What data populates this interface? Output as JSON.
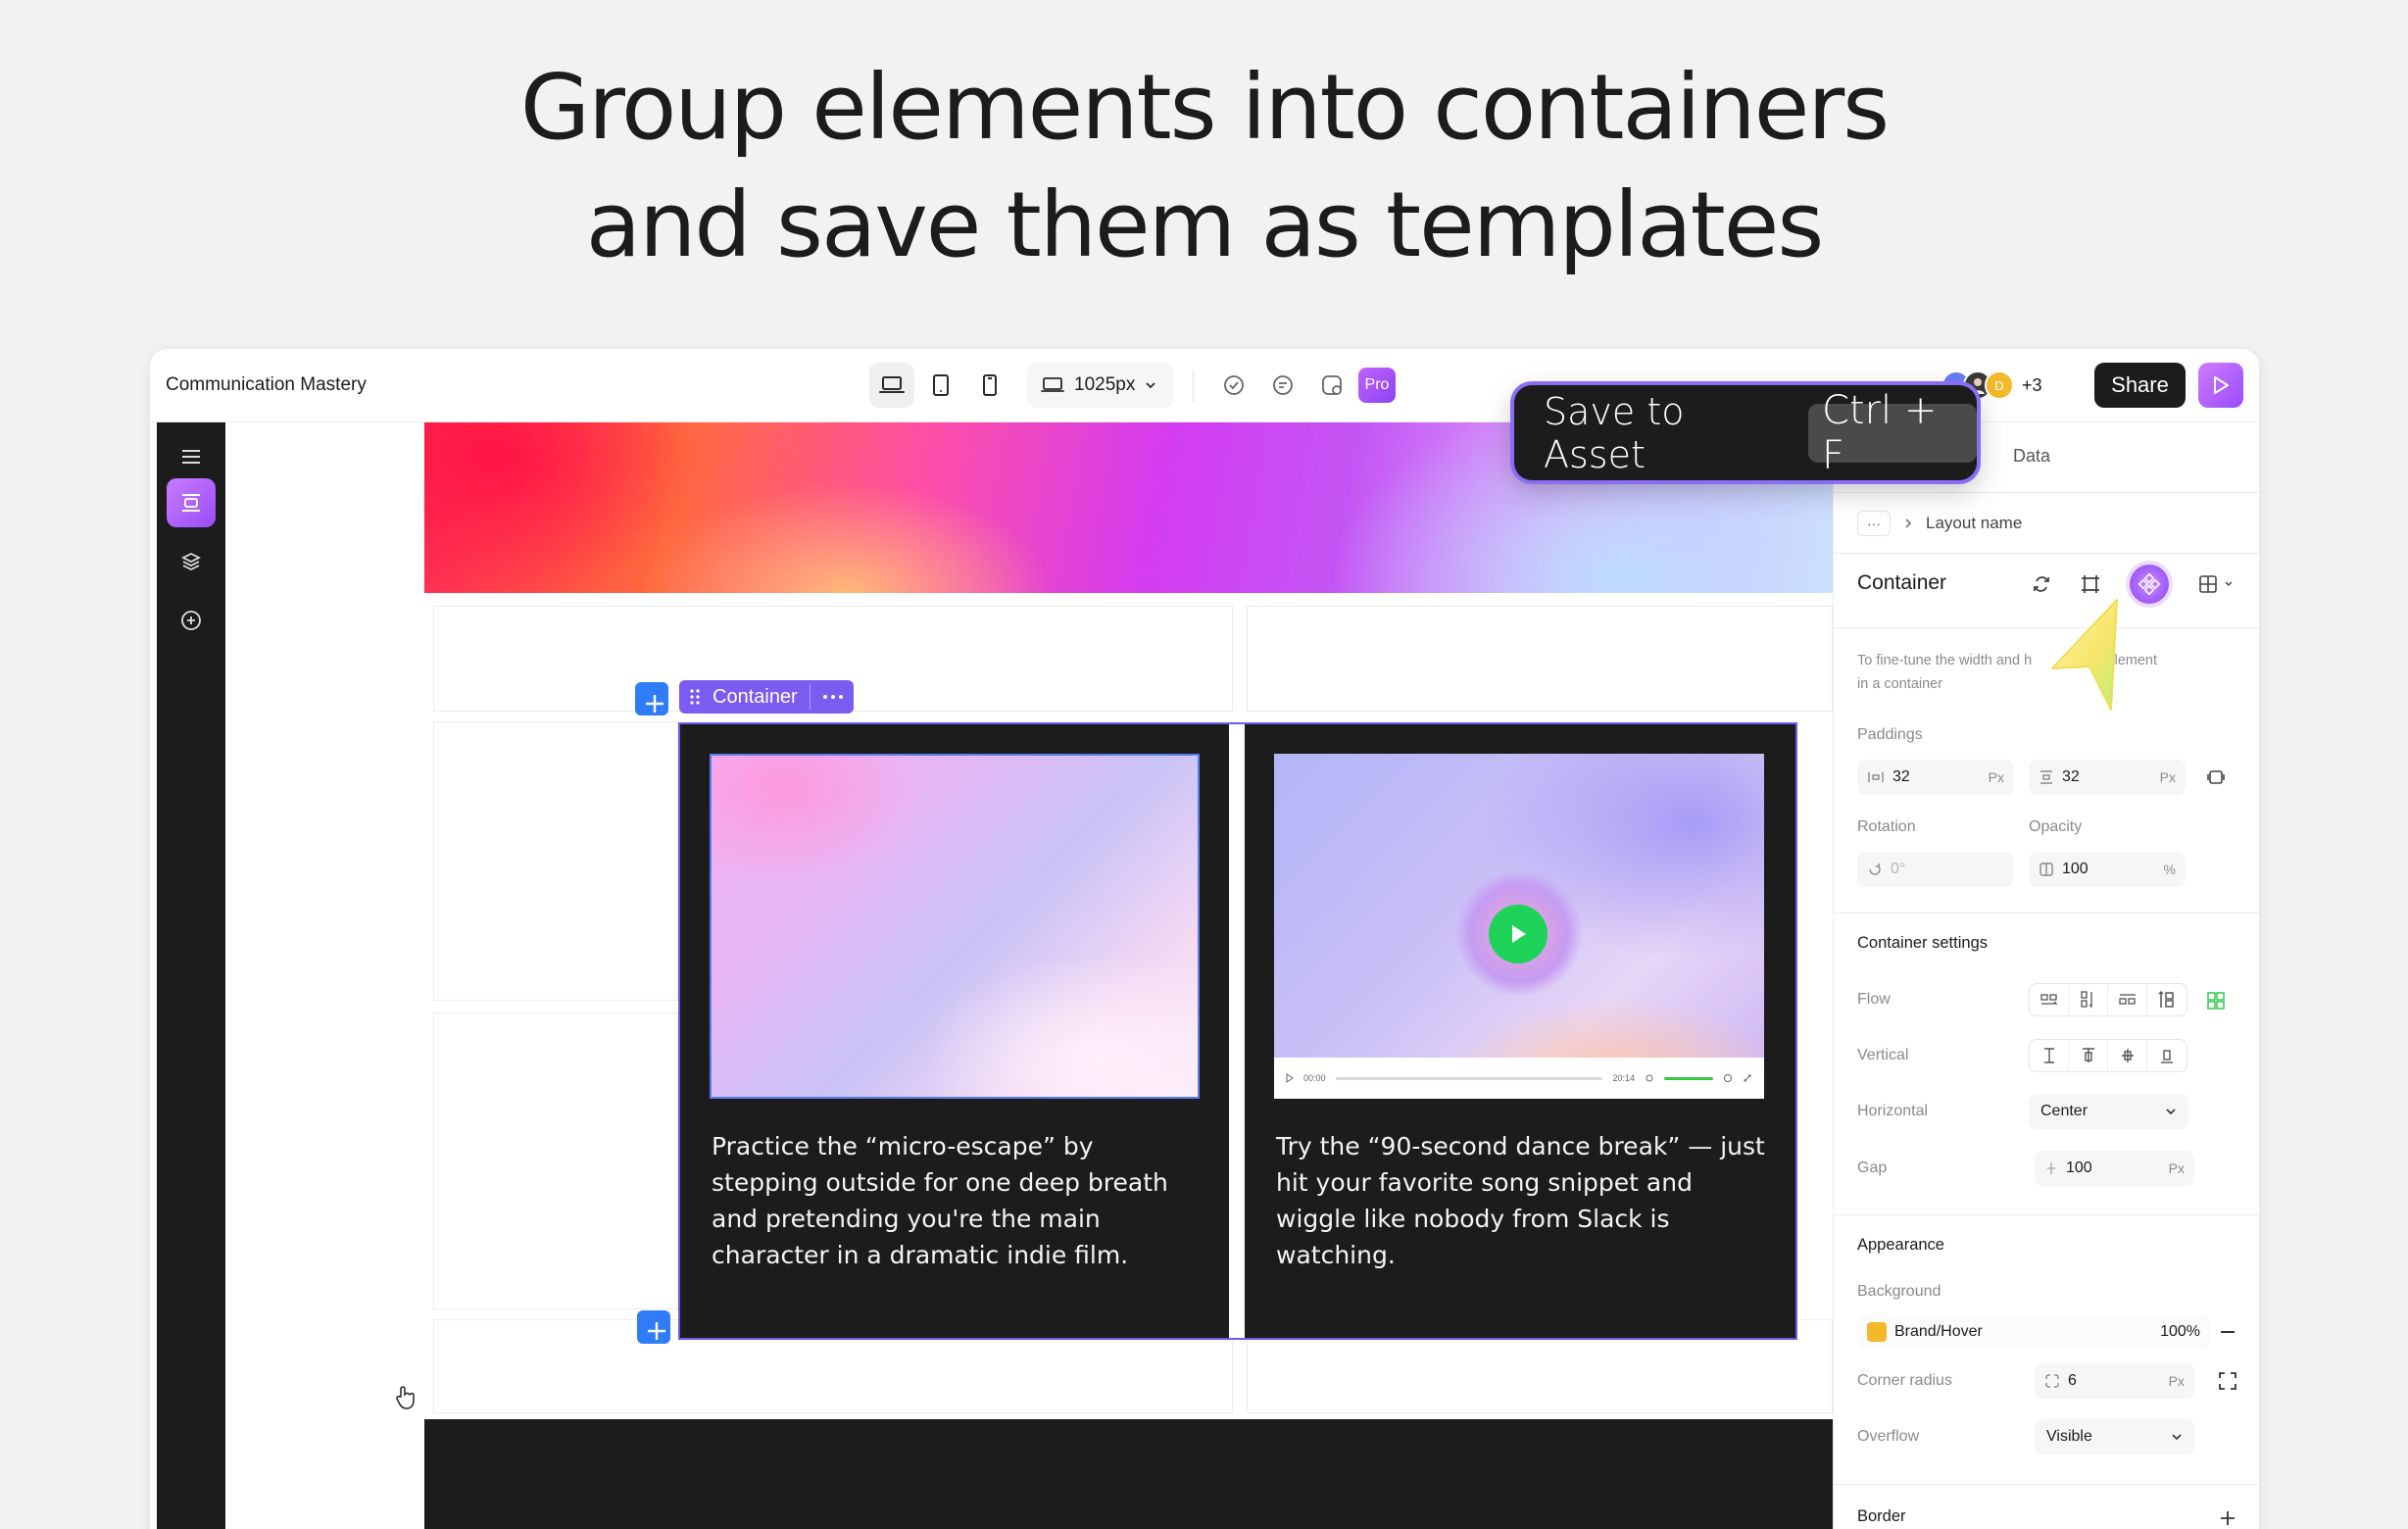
{
  "headline": {
    "line1": "Group elements into containers",
    "line2": "and save them as templates"
  },
  "topbar": {
    "title": "Communication Mastery",
    "devices": [
      "laptop-icon",
      "tablet-icon",
      "phone-icon"
    ],
    "width_value": "1025px",
    "tools": [
      "check-circle-icon",
      "comment-icon",
      "crop-icon"
    ],
    "pro_label": "Pro",
    "avatars": [
      {
        "initial": "M",
        "color": "#6b7cf5"
      },
      {
        "initial": "",
        "color": "#3a3a3a"
      },
      {
        "initial": "D",
        "color": "#f4b92a"
      }
    ],
    "more_users": "+3",
    "share_label": "Share"
  },
  "leftbar": {
    "items": [
      "menu-icon",
      "container-icon",
      "layers-icon",
      "add-circle-icon"
    ]
  },
  "canvas": {
    "container_tag_label": "Container",
    "cards": [
      {
        "text": "Practice the “micro-escape” by stepping outside for one deep breath and pretending you're the main character in a dramatic indie film."
      },
      {
        "text": "Try the “90-second dance break” — just hit your favorite song snippet and wiggle like nobody from Slack is watching.",
        "video_time_start": "00:00",
        "video_time_end": "20:14"
      }
    ]
  },
  "shortcut": {
    "label": "Save to Asset",
    "keys": "Ctrl + F"
  },
  "panel": {
    "tabs": [
      "t",
      "Data"
    ],
    "breadcrumb_more": "···",
    "breadcrumb_current": "Layout name",
    "title": "Container",
    "hint": "To fine-tune the width and h... to the element in a container",
    "hint_left": "To fine-tune the width and h",
    "hint_right": "o the element",
    "hint_line2": "in a container",
    "paddings_label": "Paddings",
    "padding_h": "32",
    "padding_v": "32",
    "px_unit": "Px",
    "rotation_label": "Rotation",
    "rotation_value": "0°",
    "opacity_label": "Opacity",
    "opacity_value": "100",
    "percent_unit": "%",
    "container_settings_title": "Container settings",
    "flow_label": "Flow",
    "vertical_label": "Vertical",
    "horizontal_label": "Horizontal",
    "horizontal_value": "Center",
    "gap_label": "Gap",
    "gap_value": "100",
    "appearance_title": "Appearance",
    "background_label": "Background",
    "background_name": "Brand/Hover",
    "background_color": "#f4b92a",
    "background_opacity": "100%",
    "corner_radius_label": "Corner radius",
    "corner_radius_value": "6",
    "overflow_label": "Overflow",
    "overflow_value": "Visible",
    "border_title": "Border"
  },
  "colors": {
    "accent": "#8d43f5",
    "selection": "#5a7ef0",
    "add_button": "#2f7cf6",
    "play_green": "#1fd35a"
  }
}
